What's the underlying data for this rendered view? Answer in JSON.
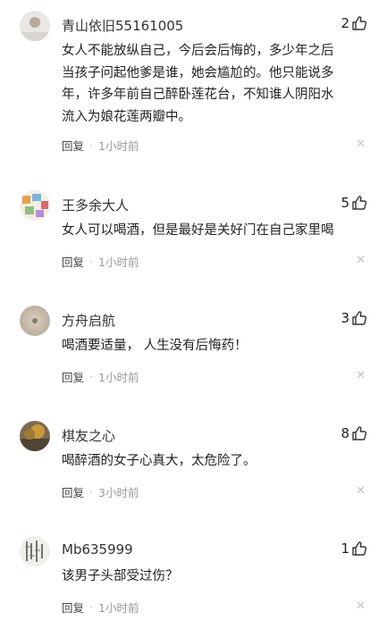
{
  "comments": [
    {
      "user": "青山依旧55161005",
      "likes": "2",
      "lines": [
        "女人不能放纵自己，今后会后悔的，多少年之后",
        "当孩子问起他爹是谁，她会尴尬的。他只能说多",
        "年，许多年前自己醉卧莲花台，不知谁人阴阳水",
        "流入为娘花莲两瓣中。"
      ],
      "reply_label": "回复",
      "separator": "·",
      "time": "1小时前",
      "close_glyph": "✕"
    },
    {
      "user": "王多余大人",
      "likes": "5",
      "lines": [
        "女人可以喝酒，但是最好是关好门在自己家里喝"
      ],
      "reply_label": "回复",
      "separator": "·",
      "time": "1小时前",
      "close_glyph": "✕"
    },
    {
      "user": "方舟启航",
      "likes": "3",
      "lines": [
        "喝酒要适量， 人生没有后悔药！"
      ],
      "reply_label": "回复",
      "separator": "·",
      "time": "1小时前",
      "close_glyph": "✕"
    },
    {
      "user": "棋友之心",
      "likes": "8",
      "lines": [
        "喝醉酒的女子心真大，太危险了。"
      ],
      "reply_label": "回复",
      "separator": "·",
      "time": "3小时前",
      "close_glyph": "✕"
    },
    {
      "user": "Mb635999",
      "likes": "1",
      "lines": [
        "该男子头部受过伤？"
      ],
      "reply_label": "回复",
      "separator": "·",
      "time": "1小时前",
      "close_glyph": "✕"
    }
  ]
}
